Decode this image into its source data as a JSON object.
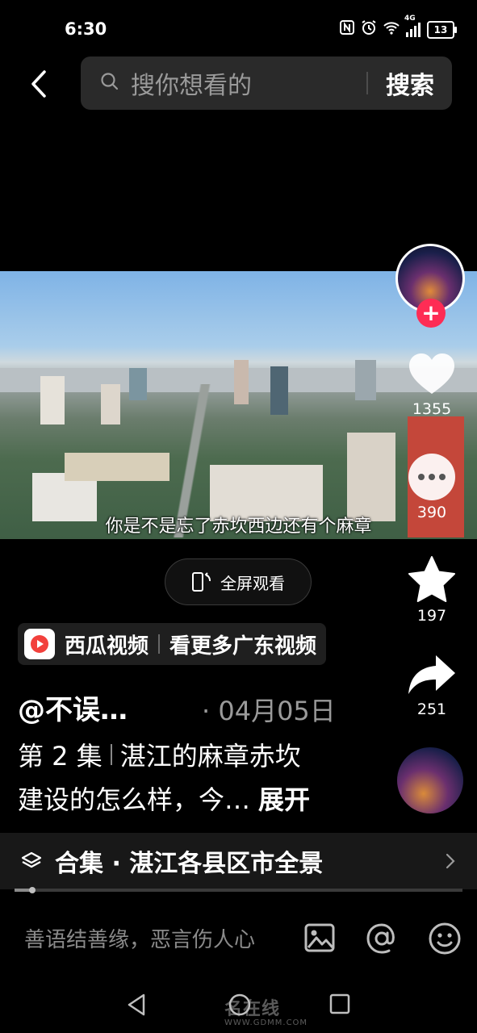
{
  "status": {
    "time": "6:30",
    "network": "4G",
    "battery": "13"
  },
  "header": {
    "search_placeholder": "搜你想看的",
    "search_button": "搜索"
  },
  "video": {
    "subtitle": "你是不是忘了赤坎西边还有个麻章",
    "fullscreen_label": "全屏观看"
  },
  "actions": {
    "like_count": "1355",
    "comment_count": "390",
    "favorite_count": "197",
    "share_count": "251",
    "follow_symbol": "+"
  },
  "promo": {
    "app_name": "西瓜视频",
    "cta": "看更多广东视频"
  },
  "post": {
    "author": "@不误…",
    "date": "· 04月05日",
    "episode": "第 2 集",
    "title_line1": "湛江的麻章赤坎",
    "title_line2": "建设的怎么样，今…",
    "expand": "展开"
  },
  "collection": {
    "label": "合集 · 湛江各县区市全景",
    "progress": 0.04
  },
  "comment": {
    "placeholder": "善语结善缘，恶言伤人心"
  },
  "watermark": {
    "main": "名在线",
    "sub": "WWW.GDMM.COM"
  },
  "colors": {
    "accent": "#fe2c55",
    "background": "#000000",
    "search_bg": "#2a2a2a",
    "xigua_red": "#f2403c"
  }
}
